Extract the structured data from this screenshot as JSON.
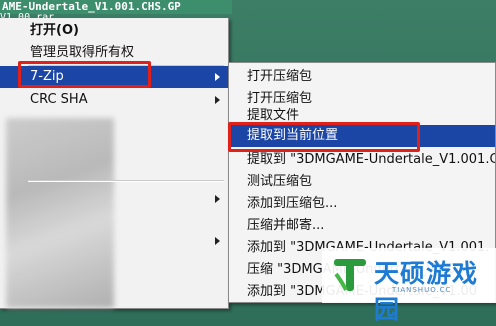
{
  "desktop": {
    "file_name": "AME-Undertale_V1.001.CHS.GP",
    "file_name_line2": "V1.00.rar"
  },
  "context_menu": {
    "open": "打开(O)",
    "run_as_admin": "管理员取得所有权",
    "seven_zip": "7-Zip",
    "crc_sha": "CRC SHA"
  },
  "submenu": {
    "items": [
      "打开压缩包",
      "打开压缩包",
      "提取文件",
      "提取到当前位置",
      "提取到 \"3DMGAME-Undertale_V1.001.C",
      "测试压缩包",
      "添加到压缩包...",
      "压缩并邮寄...",
      "添加到 \"3DMGAME-Undertale_V1.001.",
      "压缩 \"3DMGAME-Undertale_V1.001.",
      "添加到 \"3DMGAME-Undertale_V1.00"
    ]
  },
  "watermark": {
    "brand": "天硕游戏园",
    "domain": "TIANSHUO.CC"
  },
  "colors": {
    "highlight": "#1c46a5",
    "annotation_red": "#e0201a",
    "menu_bg": "#f2f2f2",
    "watermark_blue": "#1d7bd3"
  }
}
